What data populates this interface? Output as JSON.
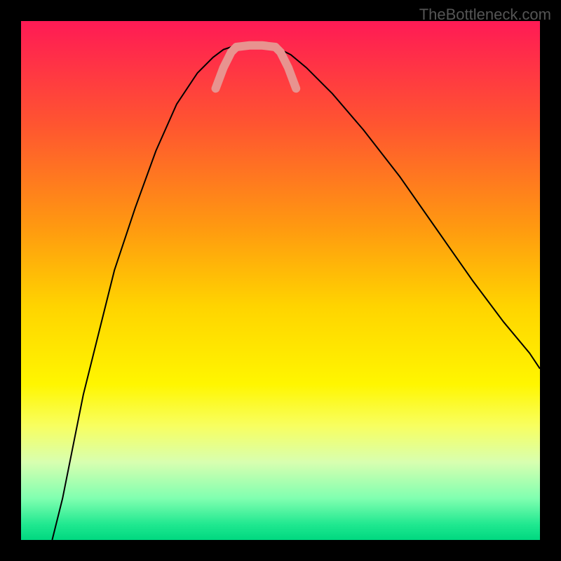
{
  "watermark": "TheBottleneck.com",
  "chart_data": {
    "type": "line",
    "title": "",
    "xlabel": "",
    "ylabel": "",
    "xlim": [
      0,
      100
    ],
    "ylim": [
      0,
      100
    ],
    "gradient_stops": [
      {
        "offset": 0,
        "color": "#ff1a55"
      },
      {
        "offset": 20,
        "color": "#ff5530"
      },
      {
        "offset": 40,
        "color": "#ff9a10"
      },
      {
        "offset": 55,
        "color": "#ffd400"
      },
      {
        "offset": 70,
        "color": "#fff600"
      },
      {
        "offset": 78,
        "color": "#f8ff60"
      },
      {
        "offset": 85,
        "color": "#d8ffb0"
      },
      {
        "offset": 92,
        "color": "#80ffb0"
      },
      {
        "offset": 97,
        "color": "#20e890"
      },
      {
        "offset": 100,
        "color": "#00d880"
      }
    ],
    "series": [
      {
        "name": "left-curve",
        "color": "#000000",
        "width": 2,
        "x": [
          6,
          8,
          10,
          12,
          15,
          18,
          22,
          26,
          30,
          34,
          37,
          39,
          40.5
        ],
        "y": [
          0,
          8,
          18,
          28,
          40,
          52,
          64,
          75,
          84,
          90,
          93,
          94.5,
          95
        ]
      },
      {
        "name": "right-curve",
        "color": "#000000",
        "width": 2,
        "x": [
          49,
          50,
          52,
          55,
          60,
          66,
          73,
          80,
          87,
          93,
          98,
          100
        ],
        "y": [
          95,
          94.5,
          93.5,
          91,
          86,
          79,
          70,
          60,
          50,
          42,
          36,
          33
        ]
      },
      {
        "name": "highlight-left",
        "color": "#e8938f",
        "width": 12,
        "cap": "round",
        "x": [
          37.5,
          39,
          40.5,
          41.5
        ],
        "y": [
          87,
          91,
          94,
          95
        ]
      },
      {
        "name": "highlight-bottom",
        "color": "#e8938f",
        "width": 12,
        "cap": "round",
        "x": [
          41.5,
          44,
          46.5,
          49
        ],
        "y": [
          95,
          95.3,
          95.3,
          95
        ]
      },
      {
        "name": "highlight-right",
        "color": "#e8938f",
        "width": 12,
        "cap": "round",
        "x": [
          49,
          50,
          51.5,
          53
        ],
        "y": [
          95,
          94,
          91,
          87
        ]
      }
    ]
  }
}
